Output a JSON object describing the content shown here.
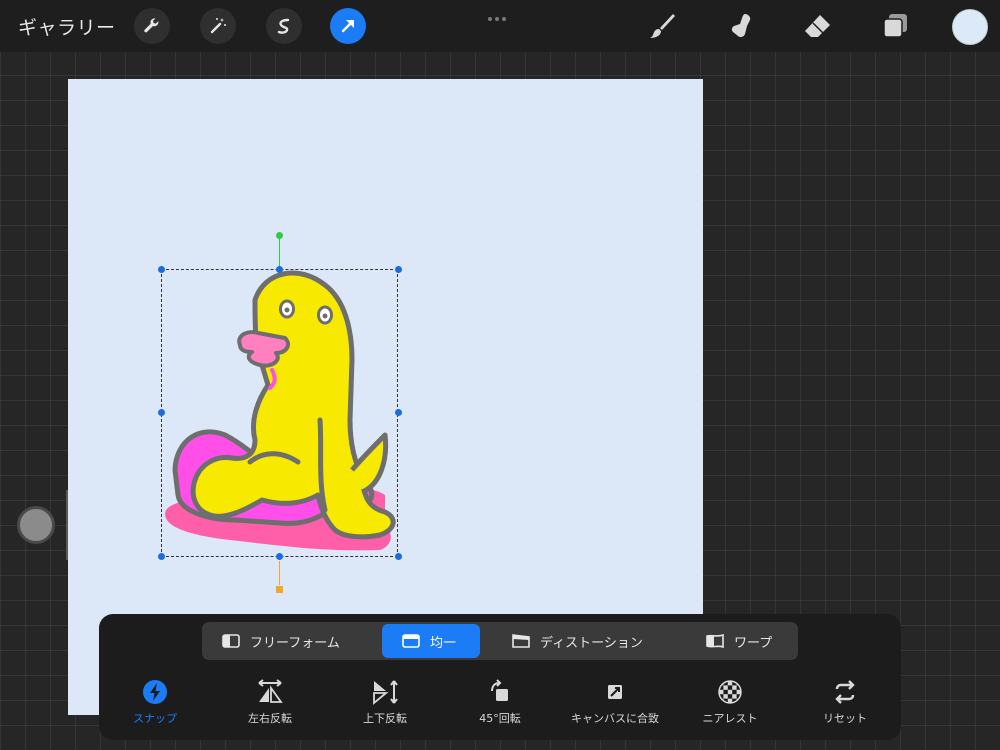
{
  "topbar": {
    "gallery_label": "ギャラリー",
    "left_tools": [
      {
        "name": "wrench-icon",
        "active": false
      },
      {
        "name": "magic-wand-icon",
        "active": false
      },
      {
        "name": "selection-icon",
        "active": false
      },
      {
        "name": "transform-arrow-icon",
        "active": true
      }
    ],
    "right_tools": [
      "brush-icon",
      "smudge-icon",
      "eraser-icon",
      "layers-icon"
    ],
    "current_color": "#dce9f9"
  },
  "canvas": {
    "background": "#dce8f8"
  },
  "transform_modes": {
    "freeform": "フリーフォーム",
    "uniform": "均一",
    "distort": "ディストーション",
    "warp": "ワープ",
    "active": "uniform"
  },
  "transform_tools": {
    "snap": "スナップ",
    "flip_horizontal": "左右反転",
    "flip_vertical": "上下反転",
    "rotate_45": "45°回転",
    "fit_canvas": "キャンバスに合致",
    "nearest": "ニアレスト",
    "reset": "リセット"
  },
  "colors": {
    "accent": "#1b7cf5",
    "character_yellow": "#f7ea00",
    "character_pink": "#ff4fe8",
    "shadow_pink": "#ff5fa8",
    "outline": "#6e6e6e"
  }
}
